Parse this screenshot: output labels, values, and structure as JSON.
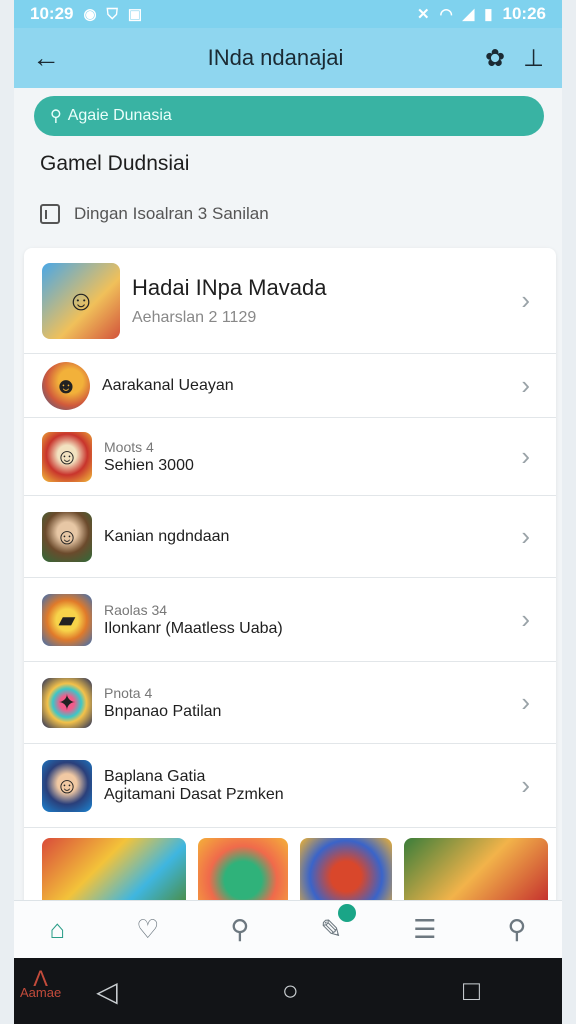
{
  "status": {
    "time_left": "10:29",
    "time_right": "10:26"
  },
  "app_bar": {
    "title": "INda ndanajai"
  },
  "search": {
    "placeholder": "Agaie Dunasia"
  },
  "section": {
    "title": "Gamel Dudnsiai",
    "subtitle": "Dingan Isoalran 3 Sanilan"
  },
  "featured": {
    "title": "Hadai INpa Mavada",
    "meta": "Aeharslan 2 1129"
  },
  "list": [
    {
      "meta": "",
      "label": "Aarakanal Ueayan"
    },
    {
      "meta": "Moots 4",
      "label": "Sehien 3000"
    },
    {
      "meta": "",
      "label": "Kanian ngdndaan"
    },
    {
      "meta": "Raolas 34",
      "label": "Ilonkanr (Maatless Uaba)"
    },
    {
      "meta": "Pnota 4",
      "label": "Bnpanao Patilan"
    },
    {
      "meta": "Baplana Gatia",
      "label": "Agitamani Dasat Pzmken"
    }
  ],
  "brand": {
    "label": "Aamae"
  },
  "colors": {
    "accent": "#39b3a3",
    "header": "#8fd6ef",
    "nav_active": "#2a9d88"
  },
  "icons": {
    "back": "arrow-left-icon",
    "action1": "bee-icon",
    "action2": "download-icon",
    "nav": [
      "home-icon",
      "heart-shield-icon",
      "search-icon",
      "edit-icon",
      "list-icon",
      "search-icon"
    ]
  }
}
